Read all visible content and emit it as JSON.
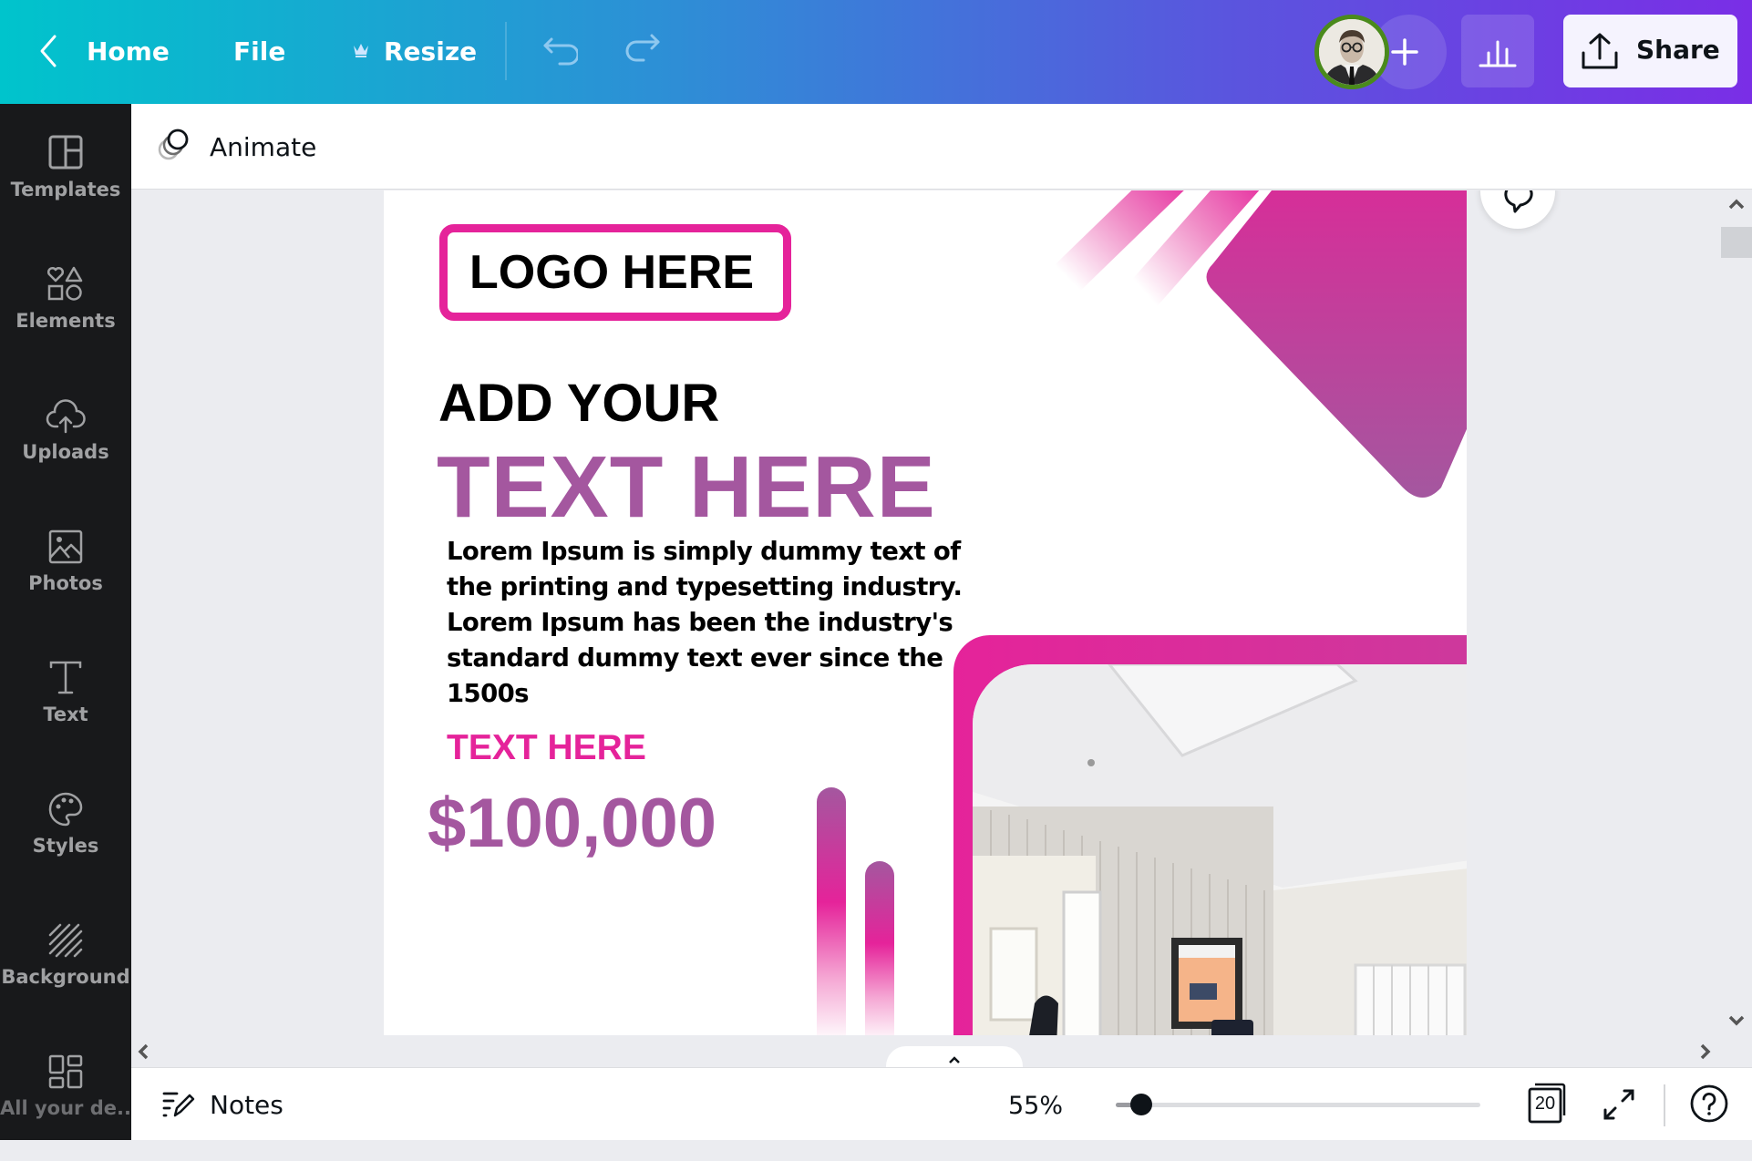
{
  "topbar": {
    "home_label": "Home",
    "file_label": "File",
    "resize_label": "Resize",
    "share_label": "Share",
    "icons": {
      "back": "chevron-left-icon",
      "resize": "crown-icon",
      "undo": "undo-icon",
      "redo": "redo-icon",
      "avatar": "user-avatar",
      "add": "plus-icon",
      "insights": "bar-chart-icon",
      "share": "upload-icon"
    }
  },
  "sidebar": {
    "items": [
      {
        "label": "Templates",
        "icon": "templates-icon"
      },
      {
        "label": "Elements",
        "icon": "elements-icon"
      },
      {
        "label": "Uploads",
        "icon": "cloud-upload-icon"
      },
      {
        "label": "Photos",
        "icon": "image-icon"
      },
      {
        "label": "Text",
        "icon": "text-icon"
      },
      {
        "label": "Styles",
        "icon": "palette-icon"
      },
      {
        "label": "Background",
        "icon": "stripes-icon"
      },
      {
        "label": "All your de...",
        "icon": "grid-icon"
      }
    ]
  },
  "animate_bar": {
    "label": "Animate",
    "icon": "animate-icon"
  },
  "design": {
    "logo_text": "LOGO HERE",
    "headline_1": "ADD YOUR",
    "headline_2": "TEXT HERE",
    "body": "Lorem Ipsum is simply dummy text of the printing and typesetting industry. Lorem Ipsum has been the industry's standard dummy text ever since the 1500s",
    "subhead": "TEXT HERE",
    "price": "$100,000",
    "colors": {
      "pink": "#e5239a",
      "purple": "#a4579f",
      "black": "#000000"
    }
  },
  "bottombar": {
    "notes_label": "Notes",
    "zoom_value": "55%",
    "zoom_percent": 55,
    "zoom_slider_fraction": 0.07,
    "page_count": "20",
    "icons": {
      "notes": "notes-icon",
      "pages": "pages-icon",
      "fullscreen": "fullscreen-icon",
      "help": "help-icon"
    }
  }
}
